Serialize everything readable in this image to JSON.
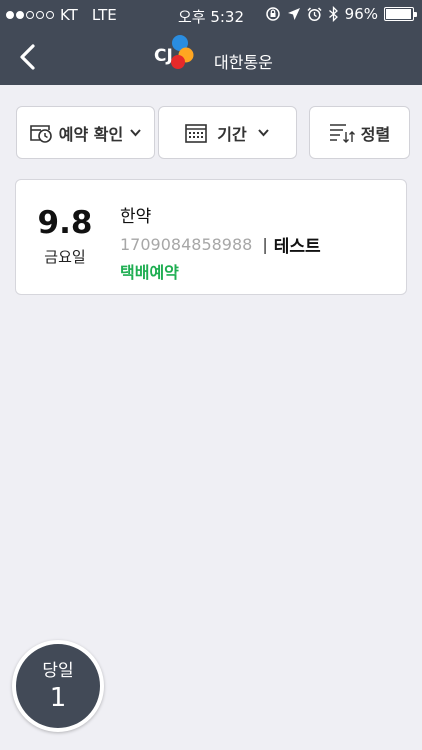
{
  "status_bar": {
    "carrier": "KT",
    "network": "LTE",
    "time": "오후 5:32",
    "battery": "96%",
    "battery_level": 0.96
  },
  "header": {
    "logo_mark": "CJ",
    "logo_text": "대한통운"
  },
  "filters": {
    "reservation_label": "예약 확인",
    "period_label": "기간",
    "sort_label": "정렬"
  },
  "items": [
    {
      "day": "9.8",
      "weekday": "금요일",
      "name": "한약",
      "tracking": "1709084858988",
      "separator": "|",
      "recipient": "테스트",
      "status": "택배예약"
    }
  ],
  "today": {
    "label": "당일",
    "count": "1"
  },
  "colors": {
    "header_bg": "#424a57",
    "status_green": "#1fae52",
    "page_bg": "#efeff4"
  }
}
